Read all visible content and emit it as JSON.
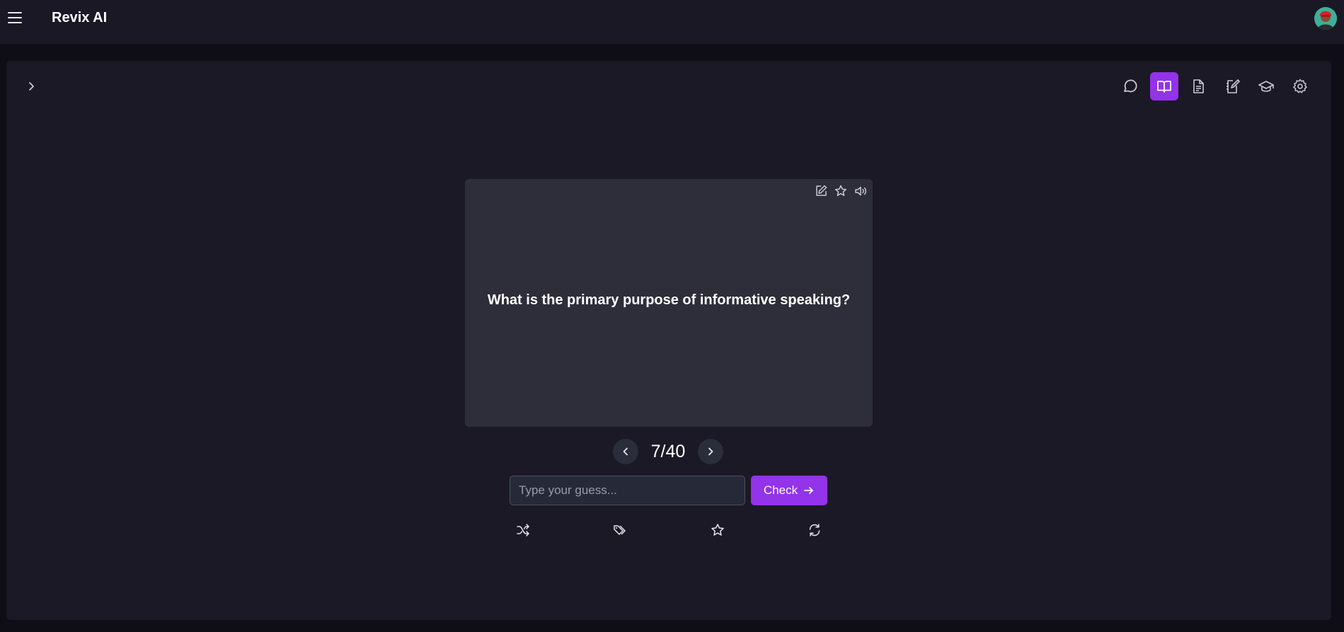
{
  "header": {
    "app_title": "Revix AI",
    "menu_icon": "hamburger-menu-icon",
    "avatar_icon": "user-avatar"
  },
  "toolbar": {
    "items": [
      {
        "icon": "chat-bubble-icon",
        "active": false
      },
      {
        "icon": "open-book-icon",
        "active": true
      },
      {
        "icon": "document-icon",
        "active": false
      },
      {
        "icon": "notebook-edit-icon",
        "active": false
      },
      {
        "icon": "graduation-cap-icon",
        "active": false
      },
      {
        "icon": "gear-icon",
        "active": false
      }
    ]
  },
  "flashcard": {
    "question": "What is the primary purpose of informative speaking?",
    "actions": [
      "edit-icon",
      "star-icon",
      "speaker-icon"
    ]
  },
  "pager": {
    "current": 7,
    "total": 40,
    "label": "7/40"
  },
  "guess": {
    "placeholder": "Type your guess...",
    "value": "",
    "check_label": "Check"
  },
  "bottom_actions": [
    "shuffle-icon",
    "tags-icon",
    "star-icon",
    "refresh-icon"
  ],
  "colors": {
    "accent": "#9333ea",
    "background": "#1b1926",
    "card": "#2e2d3a"
  }
}
